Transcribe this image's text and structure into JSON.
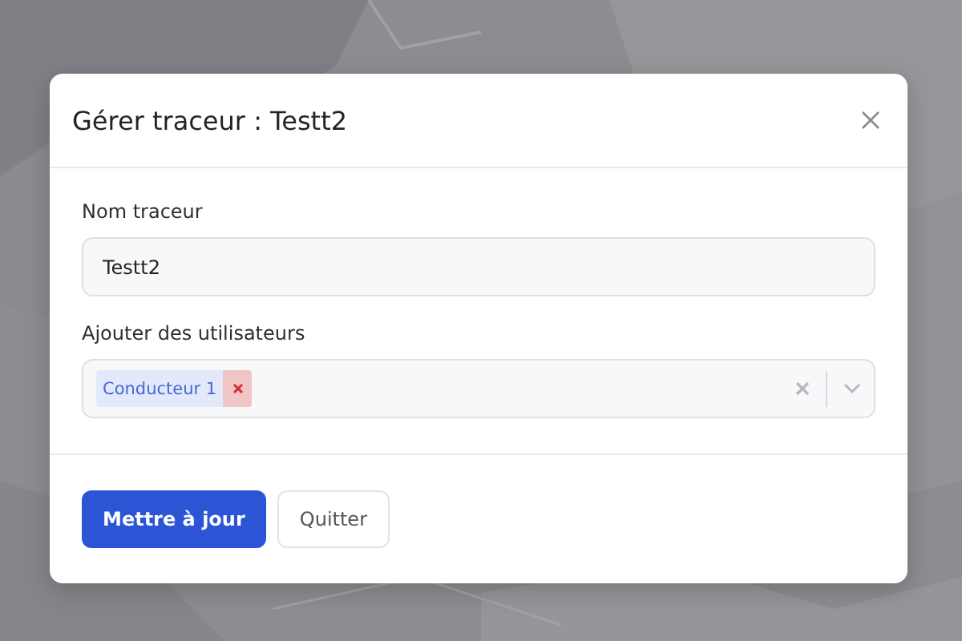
{
  "dialog": {
    "title": "Gérer traceur : Testt2",
    "fields": [
      {
        "kind": "text",
        "label": "Nom traceur",
        "value": "Testt2"
      },
      {
        "kind": "multiselect",
        "label": "Ajouter des utilisateurs",
        "chips": [
          "Conducteur 1"
        ]
      }
    ],
    "buttons": [
      {
        "label": "Mettre à jour",
        "kind": "primary"
      },
      {
        "label": "Quitter",
        "kind": "secondary"
      }
    ]
  }
}
